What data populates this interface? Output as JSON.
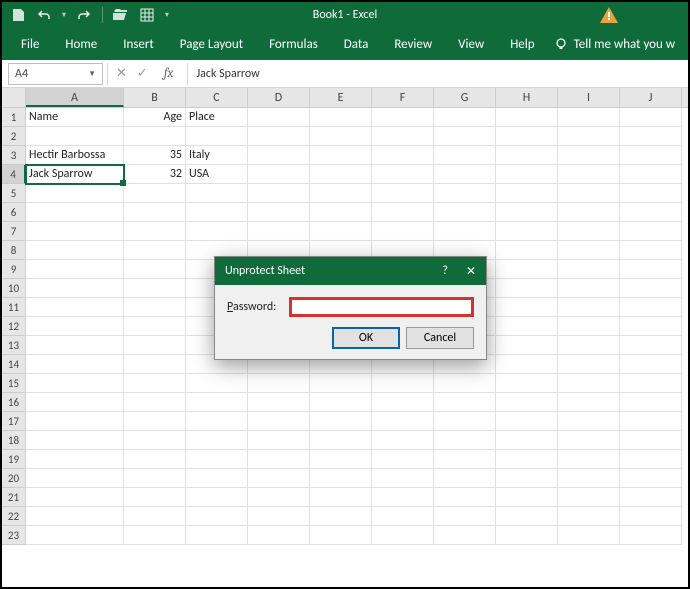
{
  "title": "Book1 - Excel",
  "qat": {
    "save": "save-icon",
    "undo": "undo-icon",
    "redo": "redo-icon",
    "open": "open-icon",
    "quickprint": "quickprint-icon"
  },
  "ribbon": [
    "File",
    "Home",
    "Insert",
    "Page Layout",
    "Formulas",
    "Data",
    "Review",
    "View",
    "Help"
  ],
  "tellme": "Tell me what you w",
  "namebox": "A4",
  "formula": "Jack Sparrow",
  "columns": [
    "A",
    "B",
    "C",
    "D",
    "E",
    "F",
    "G",
    "H",
    "I",
    "J"
  ],
  "selected_col": "A",
  "selected_row": 4,
  "row_count": 23,
  "cells": {
    "A1": "Name",
    "B1": "Age",
    "C1": "Place",
    "A3": "Hectir Barbossa",
    "B3": "35",
    "C3": "Italy",
    "A4": "Jack Sparrow",
    "B4": "32",
    "C4": "USA"
  },
  "numeric_cols": [
    "B"
  ],
  "wide_cols": [
    "A"
  ],
  "dialog": {
    "title": "Unprotect Sheet",
    "label_prefix": "P",
    "label_rest": "assword:",
    "value": "",
    "ok": "OK",
    "cancel": "Cancel",
    "help": "?",
    "close": "✕"
  }
}
